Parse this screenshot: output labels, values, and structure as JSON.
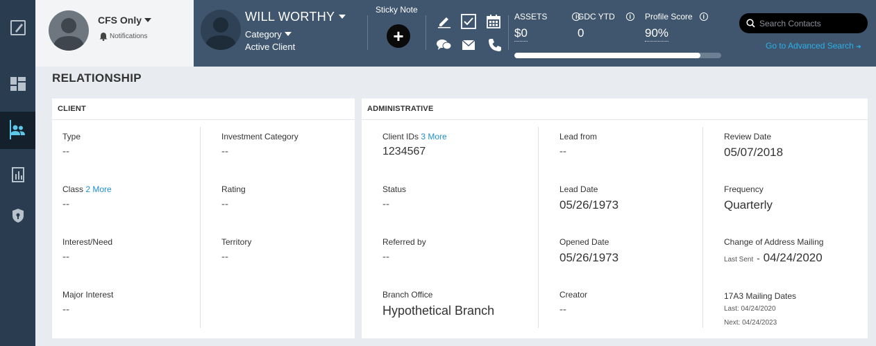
{
  "user": {
    "name": "CFS Only",
    "notifications_label": "Notifications"
  },
  "client": {
    "name": "WILL WORTHY",
    "category_label": "Category",
    "status": "Active Client"
  },
  "sticky_note": {
    "label": "Sticky Note"
  },
  "metrics": {
    "assets": {
      "label": "ASSETS",
      "value": "$0"
    },
    "gdc_ytd": {
      "label": "GDC YTD",
      "value": "0"
    },
    "profile_score": {
      "label": "Profile Score",
      "value": "90%",
      "fraction": 0.9
    }
  },
  "search": {
    "placeholder": "Search Contacts",
    "advanced_link": "Go to Advanced Search"
  },
  "page": {
    "title": "RELATIONSHIP"
  },
  "client_card": {
    "title": "CLIENT",
    "type": {
      "label": "Type",
      "value": "--"
    },
    "investment_category": {
      "label": "Investment Category",
      "value": "--"
    },
    "class": {
      "label": "Class",
      "more": "2 More",
      "value": "--"
    },
    "rating": {
      "label": "Rating",
      "value": "--"
    },
    "interest_need": {
      "label": "Interest/Need",
      "value": "--"
    },
    "territory": {
      "label": "Territory",
      "value": "--"
    },
    "major_interest": {
      "label": "Major Interest",
      "value": "--"
    }
  },
  "admin_card": {
    "title": "ADMINISTRATIVE",
    "client_ids": {
      "label": "Client IDs",
      "more": "3 More",
      "value": "1234567"
    },
    "status": {
      "label": "Status",
      "value": "--"
    },
    "referred_by": {
      "label": "Referred by",
      "value": "--"
    },
    "branch_office": {
      "label": "Branch Office",
      "value": "Hypothetical Branch"
    },
    "lead_from": {
      "label": "Lead from",
      "value": "--"
    },
    "lead_date": {
      "label": "Lead Date",
      "value": "05/26/1973"
    },
    "opened_date": {
      "label": "Opened Date",
      "value": "05/26/1973"
    },
    "creator": {
      "label": "Creator",
      "value": "--"
    },
    "review_date": {
      "label": "Review Date",
      "value": "05/07/2018"
    },
    "frequency": {
      "label": "Frequency",
      "value": "Quarterly"
    },
    "change_of_address": {
      "label": "Change of Address Mailing",
      "last_sent_label": "Last Sent",
      "separator": "-",
      "value": "04/24/2020"
    },
    "mailing_17a3": {
      "label": "17A3 Mailing Dates",
      "last_label": "Last:",
      "last_value": "04/24/2020",
      "next_label": "Next:",
      "next_value": "04/24/2023"
    }
  },
  "colors": {
    "rail": "#2a3c50",
    "topbar": "#40566e",
    "accent": "#5ec8ea",
    "link": "#1f8fcf"
  }
}
